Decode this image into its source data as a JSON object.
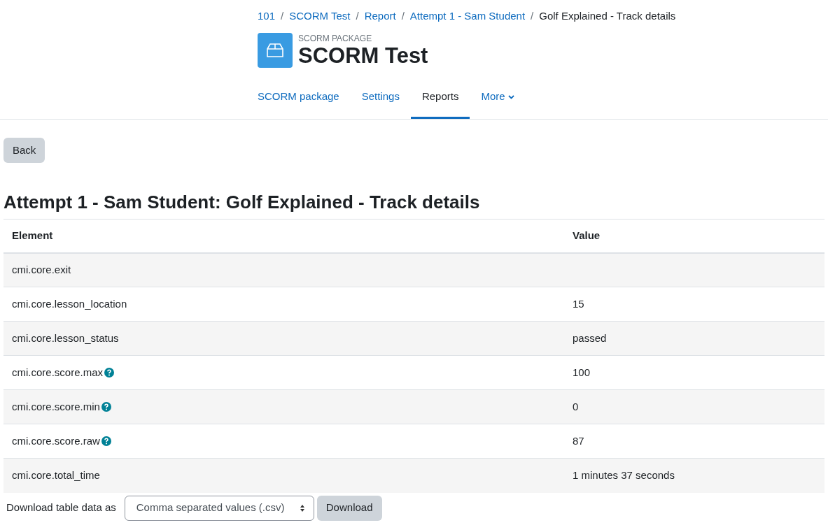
{
  "breadcrumb": [
    {
      "label": "101",
      "link": true
    },
    {
      "label": "SCORM Test",
      "link": true
    },
    {
      "label": "Report",
      "link": true
    },
    {
      "label": "Attempt 1 - Sam Student",
      "link": true
    },
    {
      "label": "Golf Explained - Track details",
      "link": false
    }
  ],
  "separator": "/",
  "header": {
    "subtitle": "SCORM PACKAGE",
    "title": "SCORM Test"
  },
  "tabs": [
    {
      "label": "SCORM package",
      "selected": false,
      "dropdown": false
    },
    {
      "label": "Settings",
      "selected": false,
      "dropdown": false
    },
    {
      "label": "Reports",
      "selected": true,
      "dropdown": false
    },
    {
      "label": "More",
      "selected": false,
      "dropdown": true
    }
  ],
  "back_button": "Back",
  "heading": "Attempt 1 - Sam Student: Golf Explained - Track details",
  "table": {
    "columns": [
      "Element",
      "Value"
    ],
    "rows": [
      {
        "element": "cmi.core.exit",
        "value": "",
        "help": false
      },
      {
        "element": "cmi.core.lesson_location",
        "value": "15",
        "help": false
      },
      {
        "element": "cmi.core.lesson_status",
        "value": "passed",
        "help": false
      },
      {
        "element": "cmi.core.score.max",
        "value": "100",
        "help": true
      },
      {
        "element": "cmi.core.score.min",
        "value": "0",
        "help": true
      },
      {
        "element": "cmi.core.score.raw",
        "value": "87",
        "help": true
      },
      {
        "element": "cmi.core.total_time",
        "value": "1 minutes 37 seconds",
        "help": false
      }
    ]
  },
  "download": {
    "label": "Download table data as",
    "format": "Comma separated values (.csv)",
    "button": "Download"
  }
}
